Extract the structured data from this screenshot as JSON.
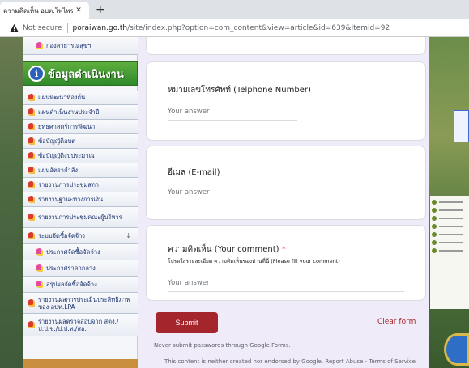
{
  "browser": {
    "tab_title": "ความคิดเห็น อบต.โพไพร",
    "new_tab_symbol": "+",
    "not_secure": "Not secure",
    "url_host": "poraiwan.go.th",
    "url_path": "/site/index.php?option=com_content&view=article&id=639&Itemid=92"
  },
  "sidebar": {
    "top_item": "กองสาธารณสุขฯ",
    "header": "ข้อมูลดำเนินงาน",
    "items": [
      "แผนพัฒนาท้องถิ่น",
      "แผนดำเนินงานประจำปี",
      "ยุทธศาสตร์การพัฒนา",
      "ข้อบัญญัติอบต",
      "ข้อบัญญัติงบประมาณ",
      "แผนอัตรากำลัง",
      "รายงานการประชุมสภา",
      "รายงานฐานะทางการเงิน",
      "รายงานการประชุมคณะผู้บริหาร",
      "ระบบจัดซื้อจัดจ้าง"
    ],
    "sub_items": [
      "ประกาศจัดซื้อจัดจ้าง",
      "ประกาศราคากลาง",
      "สรุปผลจัดซื้อจัดจ้าง"
    ],
    "bottom_items": [
      "รายงานผลการประเมินประสิทธิภาพของ อปท.LPA",
      "รายงานผลตรวจสอบจาก สตง./ป.ป.ช./ป.ป.ท./สถ."
    ]
  },
  "form": {
    "phone": {
      "title": "หมายเลขโทรศัพท์ (Telphone Number)",
      "placeholder": "Your answer"
    },
    "email": {
      "title": "อีเมล (E-mail)",
      "placeholder": "Your answer"
    },
    "comment": {
      "title": "ความคิดเห็น (Your comment)",
      "required_mark": "*",
      "description": "โปรดใส่รายละเอียด ความคิดเห็นของท่านที่นี่ (Please fill your comment)",
      "placeholder": "Your answer"
    },
    "submit_label": "Submit",
    "clear_label": "Clear form",
    "footer_note": "Never submit passwords through Google Forms.",
    "footer_disclaimer": "This content is neither created nor endorsed by Google. Report Abuse - Terms of Service"
  },
  "colors": {
    "accent": "#a4262c",
    "form_bg": "#f0ebf8",
    "sidebar_header": "#2f8a2a"
  }
}
